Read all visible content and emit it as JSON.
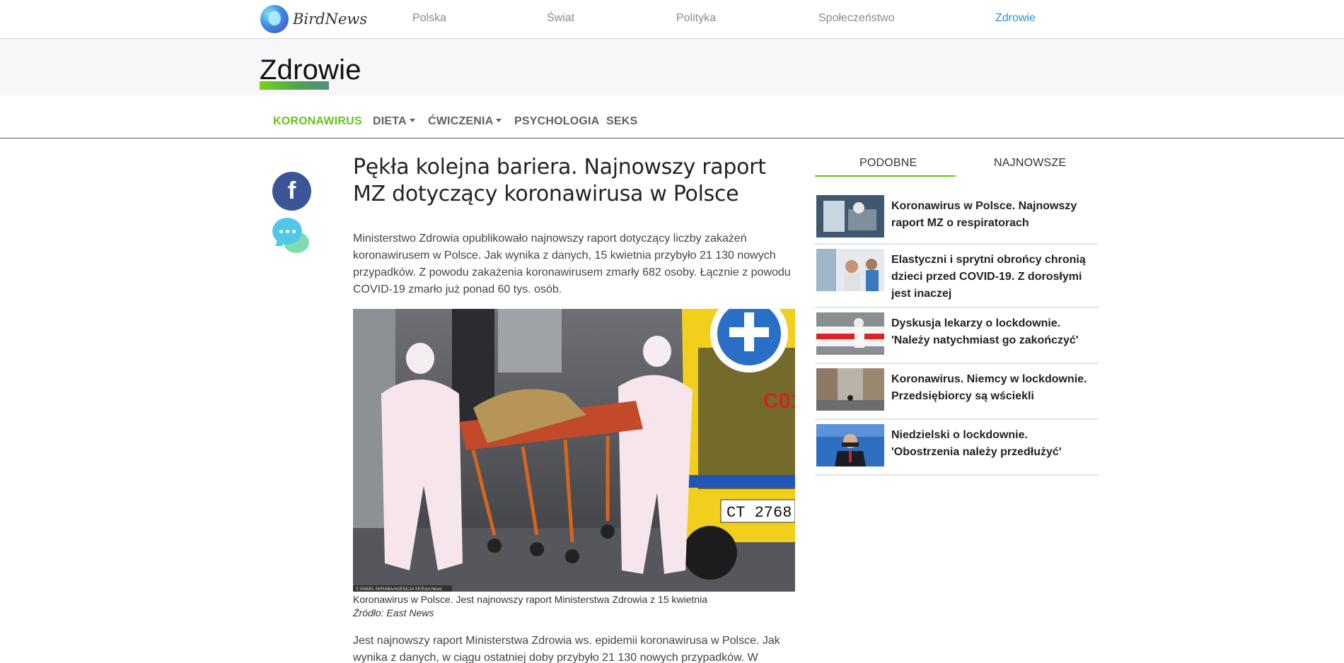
{
  "brand": {
    "name": "BirdNews"
  },
  "topnav": {
    "items": [
      {
        "label": "Polska"
      },
      {
        "label": "Świat"
      },
      {
        "label": "Polityka"
      },
      {
        "label": "Społeczeństwo"
      },
      {
        "label": "Zdrowie"
      }
    ],
    "active": "Zdrowie"
  },
  "category": {
    "title": "Zdrowie"
  },
  "subnav": {
    "items": [
      {
        "label": "KORONAWIRUS",
        "active": true
      },
      {
        "label": "DIETA",
        "dropdown": true
      },
      {
        "label": "ĆWICZENIA",
        "dropdown": true
      },
      {
        "label": "PSYCHOLOGIA"
      },
      {
        "label": "SEKS"
      }
    ]
  },
  "share": {
    "facebook_glyph": "f",
    "icons": [
      "facebook-icon",
      "chat-bubbles-icon"
    ]
  },
  "article": {
    "title": "Pękła kolejna bariera. Najnowszy raport MZ dotyczący koronawirusa w Polsce",
    "lead": "Ministerstwo Zdrowia opublikowało najnowszy raport dotyczący liczby zakażeń koronawirusem w Polsce. Jak wynika z danych, 15 kwietnia przybyło 21 130 nowych przypadków. Z powodu zakażenia koronawirusem zmarły 682 osoby. Łącznie z powodu COVID-19 zmarło już ponad 60 tys. osób.",
    "image_credit": "© PAWEL SKRABA/AGENCJA SE/East News",
    "image_plate": "CT 2768",
    "image_ambulance_text": "C01",
    "caption": "Koronawirus w Polsce. Jest najnowszy raport Ministerstwa Zdrowia z 15 kwietnia",
    "source": "Źródło: East News",
    "body": "Jest najnowszy raport Ministerstwa Zdrowia ws. epidemii koronawirusa w Polsce. Jak wynika z danych, w ciągu ostatniej doby przybyło 21 130 nowych przypadków. W"
  },
  "sidebar": {
    "tabs": [
      {
        "label": "PODOBNE",
        "active": true
      },
      {
        "label": "NAJNOWSZE"
      }
    ],
    "related": [
      {
        "title": "Koronawirus w Polsce. Najnowszy raport MZ o respiratorach"
      },
      {
        "title": "Elastyczni i sprytni obrońcy chronią dzieci przed COVID-19. Z dorosłymi jest inaczej"
      },
      {
        "title": "Dyskusja lekarzy o lockdownie. 'Należy natychmiast go zakończyć'"
      },
      {
        "title": "Koronawirus. Niemcy w lockdownie. Przedsiębiorcy są wściekli"
      },
      {
        "title": "Niedzielski o lockdownie. 'Obostrzenia należy przedłużyć'"
      }
    ]
  },
  "colors": {
    "accent_green": "#6bc01a",
    "accent_blue": "#2d8fd5",
    "facebook": "#3b5598"
  }
}
